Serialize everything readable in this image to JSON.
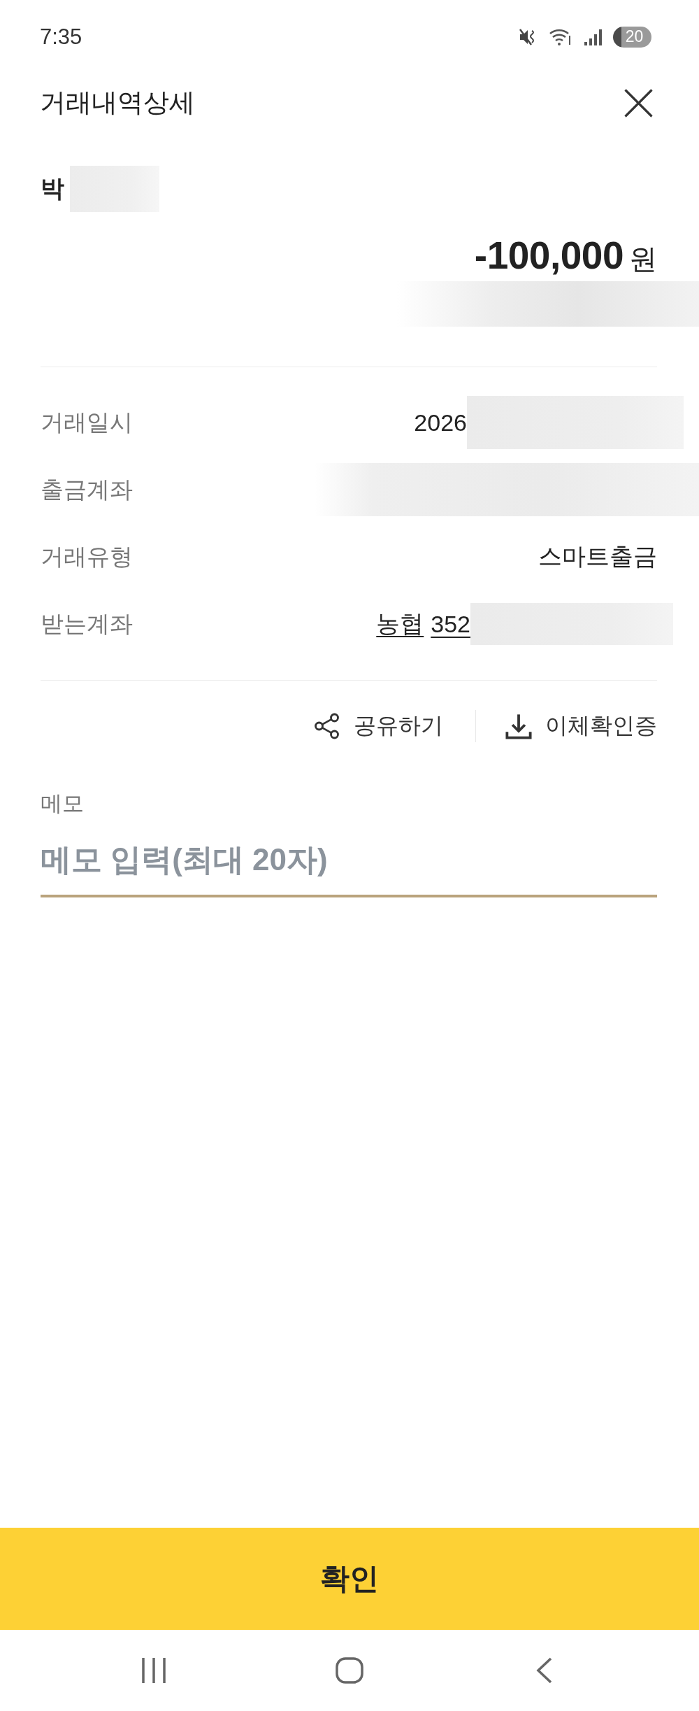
{
  "status_bar": {
    "time": "7:35",
    "battery": "20"
  },
  "header": {
    "title": "거래내역상세"
  },
  "summary": {
    "name": "박",
    "name_redacted": true,
    "amount": "-100,000",
    "currency": "원",
    "note_redacted": true
  },
  "details": [
    {
      "label": "거래일시",
      "kind": "text",
      "values": [
        "2026"
      ],
      "redacted": true
    },
    {
      "label": "출금계좌",
      "kind": "blurred"
    },
    {
      "label": "거래유형",
      "kind": "text",
      "values": [
        "스마트출금"
      ],
      "redacted": false
    },
    {
      "label": "받는계좌",
      "kind": "link",
      "values": [
        "농협",
        "352"
      ],
      "redacted": true
    }
  ],
  "actions": [
    {
      "kind": "share",
      "label": "공유하기"
    },
    {
      "kind": "download",
      "label": "이체확인증"
    }
  ],
  "memo": {
    "label": "메모",
    "placeholder": "메모 입력(최대 20자)"
  },
  "confirm_button": {
    "label": "확인"
  }
}
